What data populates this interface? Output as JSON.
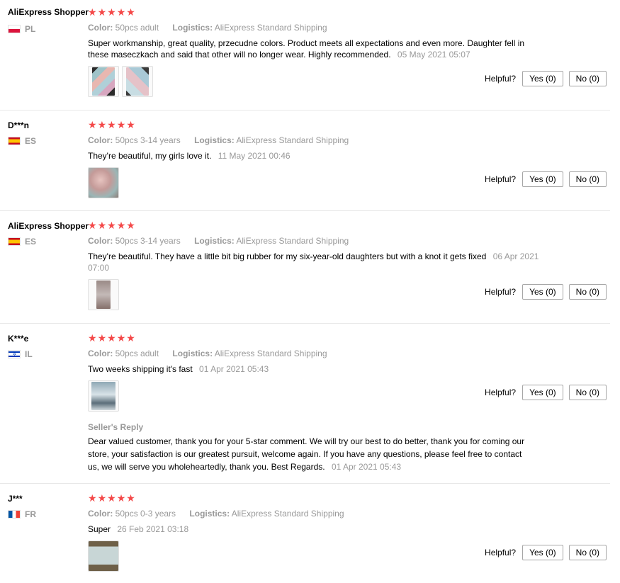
{
  "helpful_label": "Helpful?",
  "color_key": "Color:",
  "logistics_key": "Logistics:",
  "seller_reply_title": "Seller's Reply",
  "star_char": "★",
  "reviews": [
    {
      "name": "AliExpress Shopper",
      "country": "PL",
      "rating": 5,
      "color": "50pcs adult",
      "logistics": "AliExpress Standard Shipping",
      "text": "Super workmanship, great quality, przecudne colors. Product meets all expectations and even more. Daughter fell in these maseczkach and said that other will no longer wear. Highly recommended.",
      "date": "05 May 2021 05:07",
      "yes": "Yes (0)",
      "no": "No (0)"
    },
    {
      "name": "D***n",
      "country": "ES",
      "rating": 5,
      "color": "50pcs 3-14 years",
      "logistics": "AliExpress Standard Shipping",
      "text": "They're beautiful, my girls love it.",
      "date": "11 May 2021 00:46",
      "yes": "Yes (0)",
      "no": "No (0)"
    },
    {
      "name": "AliExpress Shopper",
      "country": "ES",
      "rating": 5,
      "color": "50pcs 3-14 years",
      "logistics": "AliExpress Standard Shipping",
      "text": "They're beautiful. They have a little bit big rubber for my six-year-old daughters but with a knot it gets fixed",
      "date": "06 Apr 2021 07:00",
      "yes": "Yes (0)",
      "no": "No (0)"
    },
    {
      "name": "K***e",
      "country": "IL",
      "rating": 5,
      "color": "50pcs adult",
      "logistics": "AliExpress Standard Shipping",
      "text": "Two weeks shipping it's fast",
      "date": "01 Apr 2021 05:43",
      "yes": "Yes (0)",
      "no": "No (0)",
      "seller_reply": "Dear valued customer, thank you for your 5-star comment. We will try our best to do better, thank you for coming our store, your satisfaction is our greatest pursuit, welcome again. If you have any questions, please feel free to contact us, we will serve you wholeheartedly, thank you. Best Regards.",
      "seller_reply_date": "01 Apr 2021 05:43"
    },
    {
      "name": "J***",
      "country": "FR",
      "rating": 5,
      "color": "50pcs 0-3 years",
      "logistics": "AliExpress Standard Shipping",
      "text": "Super",
      "date": "26 Feb 2021 03:18",
      "yes": "Yes (0)",
      "no": "No (0)"
    }
  ]
}
